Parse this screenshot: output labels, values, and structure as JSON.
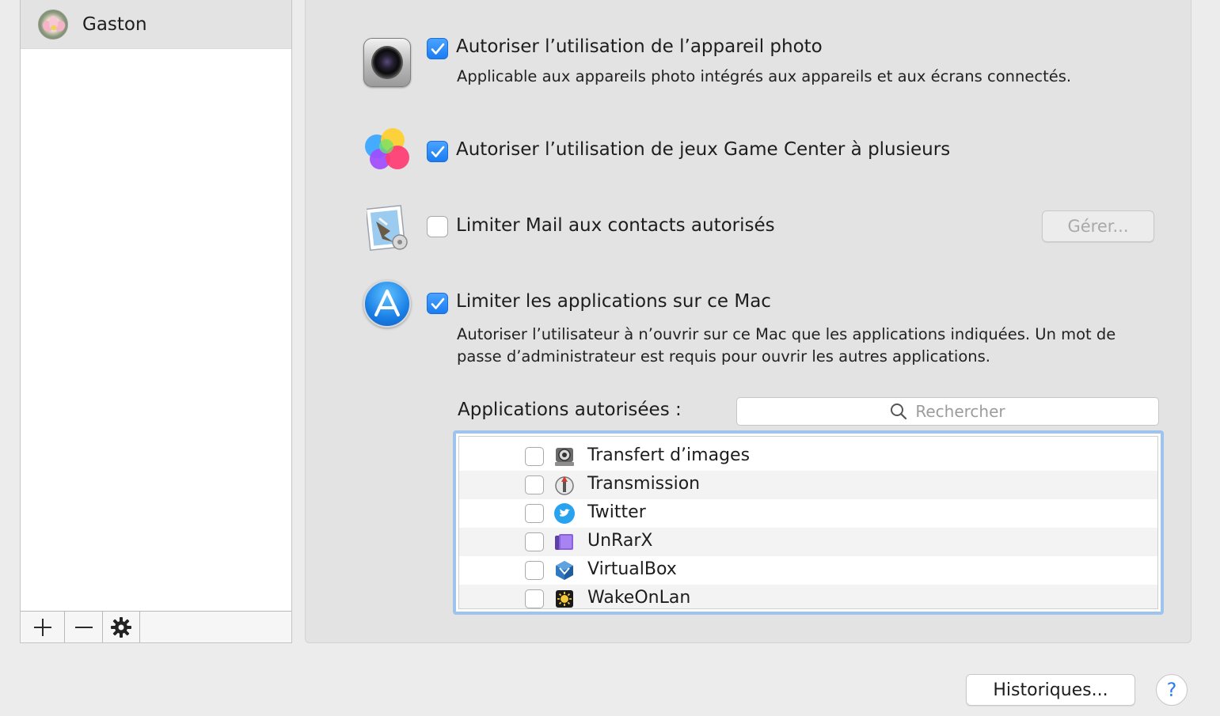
{
  "sidebar": {
    "user": {
      "name": "Gaston"
    },
    "toolbar": {
      "add": "+",
      "remove": "—"
    }
  },
  "options": {
    "camera": {
      "label": "Autoriser l’utilisation de l’appareil photo",
      "description": "Applicable aux appareils photo intégrés aux appareils et aux écrans connectés.",
      "checked": true
    },
    "gamecenter": {
      "label": "Autoriser l’utilisation de jeux Game Center à plusieurs",
      "checked": true
    },
    "mail": {
      "label": "Limiter Mail aux contacts autorisés",
      "checked": false,
      "manage_button": "Gérer..."
    },
    "apps": {
      "label": "Limiter les applications sur ce Mac",
      "description_line1": "Autoriser l’utilisateur à n’ouvrir sur ce Mac que les applications indiquées. Un mot de",
      "description_line2": "passe d’administrateur est requis pour ouvrir les autres applications.",
      "checked": true,
      "allowed_title": "Applications autorisées :",
      "search_placeholder": "Rechercher",
      "items": [
        {
          "name": "Transfert d’images",
          "checked": false,
          "icon": "image-capture-icon"
        },
        {
          "name": "Transmission",
          "checked": false,
          "icon": "transmission-icon"
        },
        {
          "name": "Twitter",
          "checked": false,
          "icon": "twitter-icon"
        },
        {
          "name": "UnRarX",
          "checked": false,
          "icon": "unrarx-icon"
        },
        {
          "name": "VirtualBox",
          "checked": false,
          "icon": "virtualbox-icon"
        },
        {
          "name": "WakeOnLan",
          "checked": false,
          "icon": "wakeonlan-icon"
        }
      ]
    }
  },
  "footer": {
    "logs_button": "Historiques...",
    "help_button": "?"
  },
  "colors": {
    "accent": "#1b7cf2",
    "list_focus": "#9ec3ec",
    "disabled_text": "#a9a9a9"
  }
}
